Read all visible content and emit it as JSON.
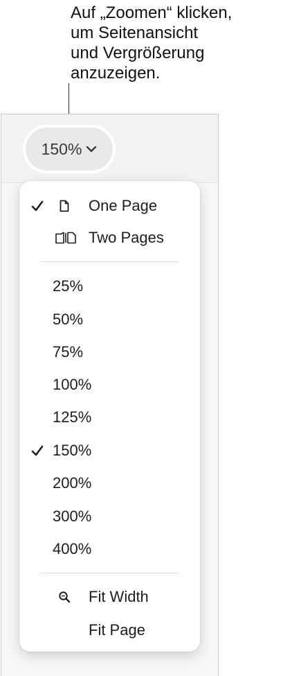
{
  "callout": {
    "lines": [
      "Auf „Zoomen“ klicken,",
      "um Seitenansicht",
      "und Vergrößerung",
      "anzuzeigen."
    ]
  },
  "toolbar": {
    "zoom_value": "150%",
    "zoom_icon": "chevron-down-icon"
  },
  "menu": {
    "view_items": [
      {
        "label": "One Page",
        "checked": true,
        "icon": "single-page-icon"
      },
      {
        "label": "Two Pages",
        "checked": false,
        "icon": "two-pages-icon"
      }
    ],
    "zoom_items": [
      {
        "label": "25%",
        "checked": false
      },
      {
        "label": "50%",
        "checked": false
      },
      {
        "label": "75%",
        "checked": false
      },
      {
        "label": "100%",
        "checked": false
      },
      {
        "label": "125%",
        "checked": false
      },
      {
        "label": "150%",
        "checked": true
      },
      {
        "label": "200%",
        "checked": false
      },
      {
        "label": "300%",
        "checked": false
      },
      {
        "label": "400%",
        "checked": false
      }
    ],
    "fit_items": [
      {
        "label": "Fit Width",
        "icon": "magnifier-icon"
      },
      {
        "label": "Fit Page",
        "icon": ""
      }
    ]
  },
  "colors": {
    "menu_background": "#ffffff",
    "button_background": "#e9e9e9",
    "text": "#1d1d1f"
  }
}
